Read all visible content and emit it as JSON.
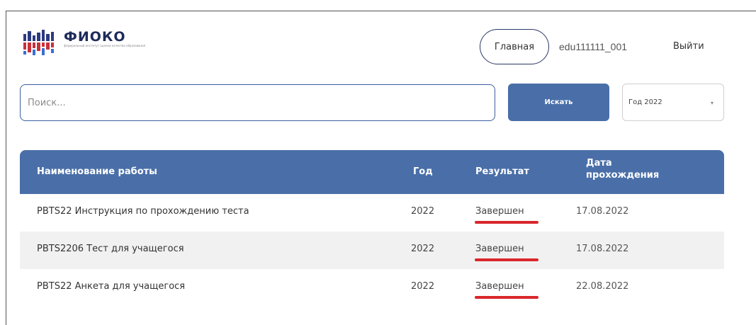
{
  "header": {
    "logo": {
      "title": "ФИОКО",
      "subtitle": "федеральный институт оценки качества образования"
    },
    "nav": {
      "home_label": "Главная",
      "username": "edu111111_001",
      "logout_label": "Выйти"
    }
  },
  "search": {
    "placeholder": "Поиск...",
    "button_label": "Искать",
    "year_select": {
      "selected": "Год 2022"
    }
  },
  "table": {
    "columns": {
      "name": "Наименование работы",
      "year": "Год",
      "result": "Результат",
      "date": "Дата прохождения"
    },
    "rows": [
      {
        "name": "PBTS22 Инструкция по прохождению теста",
        "year": "2022",
        "result": "Завершен",
        "date": "17.08.2022"
      },
      {
        "name": "PBTS2206 Тест для учащегося",
        "year": "2022",
        "result": "Завершен",
        "date": "17.08.2022"
      },
      {
        "name": "PBTS22 Анкета для учащегося",
        "year": "2022",
        "result": "Завершен",
        "date": "22.08.2022"
      }
    ]
  },
  "colors": {
    "accent": "#4a6fa8",
    "highlight": "#d9262b",
    "logo_dark": "#1d2a5a",
    "logo_red": "#c8303a"
  },
  "icons": {
    "logo": "fioko-logo-icon",
    "dropdown": "chevron-down-icon"
  }
}
